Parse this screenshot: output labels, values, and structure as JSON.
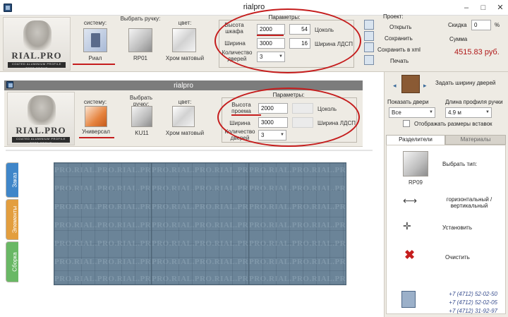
{
  "app": {
    "title": "rialpro",
    "inner_title": "rialpro"
  },
  "window_controls": {
    "minimize": "–",
    "maximize": "□",
    "close": "✕"
  },
  "logo": {
    "brand": "RIAL.PRO",
    "tagline": "COATED ALUMINIUM PROFILE TOTS GROUP"
  },
  "top_panel": {
    "system": {
      "label": "систему:",
      "value": "Риал"
    },
    "handle": {
      "label": "Выбрать ручку:",
      "value": "RP01"
    },
    "color": {
      "label": "цвет:",
      "value": "Хром матовый"
    },
    "params": {
      "title": "Параметры:",
      "height_label": "Высота шкафа",
      "height_value": "2000",
      "plinth_value": "54",
      "plinth_label": "Цоколь",
      "width_label": "Ширина",
      "width_value": "3000",
      "ldsp_value": "16",
      "ldsp_label": "Ширина ЛДСП",
      "doors_label": "Количество дверей",
      "doors_value": "3"
    },
    "project": {
      "label": "Проект:",
      "open": "Открыть",
      "save": "Сохранить",
      "save_xml": "Сохранить в xml",
      "print": "Печать"
    },
    "discount": {
      "label": "Скидка",
      "value": "0",
      "unit": "%"
    },
    "sum": {
      "label": "Сумма",
      "value": "4515.83 руб."
    }
  },
  "inner_panel": {
    "system": {
      "label": "систему:",
      "value": "Универсал"
    },
    "handle": {
      "label": "Выбрать ручку:",
      "value": "KU11"
    },
    "color": {
      "label": "цвет:",
      "value": "Хром матовый"
    },
    "params": {
      "title": "Параметры:",
      "height_label": "Высота проема",
      "height_value": "2000",
      "plinth_label": "Цоколь",
      "width_label": "Ширина",
      "width_value": "3000",
      "ldsp_label": "Ширина ЛДСП",
      "doors_label": "Количество дверей",
      "doors_value": "3"
    }
  },
  "side_tabs": [
    {
      "label": "Заказ",
      "color": "#3f86c9"
    },
    {
      "label": "Элементы",
      "color": "#e39e3e"
    },
    {
      "label": "Сборка",
      "color": "#69b865"
    }
  ],
  "watermark": "PRO.RIAL.PRO.RIAL.PRO.RIAL.PRO.RIAL",
  "right_panel": {
    "set_door_width": "Задать ширину дверей",
    "show_door_label": "Показать двери",
    "show_door_value": "Все",
    "profile_len_label": "Длина профиля ручки",
    "profile_len_value": "4.9 м",
    "show_sizes_label": "Отображать размеры вставок",
    "tabs": {
      "dividers": "Разделители",
      "materials": "Материалы"
    },
    "choose_type": "Выбрать тип:",
    "type_value": "RP09",
    "orientation": "горизонтальный / вертикальный",
    "install": "Установить",
    "clear": "Очистить",
    "phones": [
      "+7 (4712) 52-02-50",
      "+7 (4712) 52-02-05",
      "+7 (4712) 31-92-97"
    ]
  }
}
